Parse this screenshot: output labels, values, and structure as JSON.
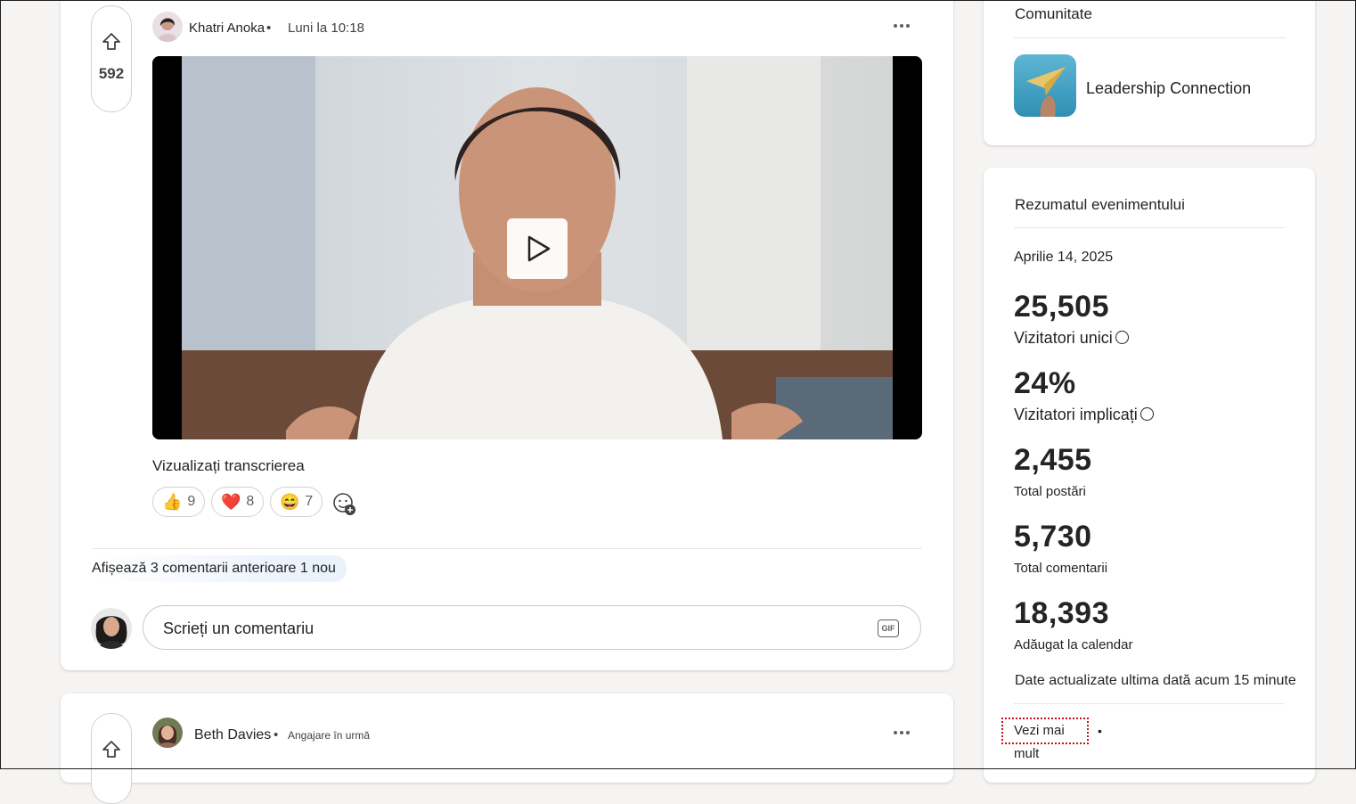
{
  "post1": {
    "votes": "592",
    "author": "Khatri Anoka",
    "separator": "•",
    "timestamp": "Luni la 10:18",
    "transcript_link": "Vizualizați transcrierea",
    "reactions": [
      {
        "emoji": "👍",
        "count": "9"
      },
      {
        "emoji": "❤️",
        "count": "8"
      },
      {
        "emoji": "😄",
        "count": "7"
      }
    ],
    "prev_comments": "Afișează 3 comentarii anterioare 1 nou",
    "comment_placeholder": "Scrieți un comentariu",
    "gif_label": "GIF"
  },
  "post2": {
    "author": "Beth Davies",
    "separator": "•",
    "meta": "Angajare în urmă"
  },
  "community": {
    "title": "Comunitate",
    "name": "Leadership Connection"
  },
  "summary": {
    "title": "Rezumatul evenimentului",
    "date": "Aprilie 14, 2025",
    "stats": [
      {
        "value": "25,505",
        "label": "Vizitatori unici"
      },
      {
        "value": "24%",
        "label": "Vizitatori implicați"
      },
      {
        "value": "2,455",
        "label": "Total postări"
      },
      {
        "value": "5,730",
        "label": "Total comentarii"
      },
      {
        "value": "18,393",
        "label": "Adăugat la calendar"
      }
    ],
    "updated": "Date actualizate ultima dată acum 15 minute",
    "see_more": "Vezi mai mult",
    "see_more_dot": "•"
  }
}
